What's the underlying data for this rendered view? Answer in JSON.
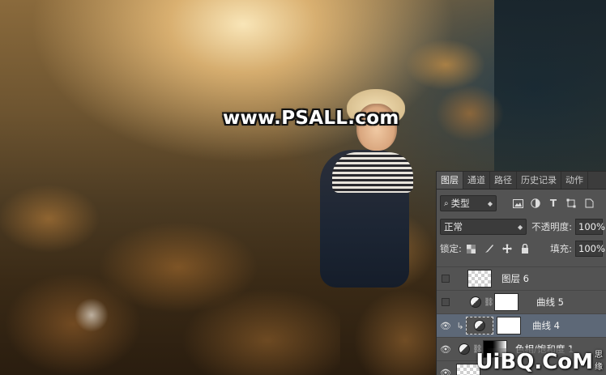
{
  "photo": {
    "watermark": "www.PSALL.com"
  },
  "layers_panel": {
    "tabs": [
      "图层",
      "通道",
      "路径",
      "历史记录",
      "动作"
    ],
    "filter": {
      "kind_label": "类型",
      "icons": [
        "image-filter-icon",
        "adjustment-filter-icon",
        "type-filter-icon",
        "shape-filter-icon",
        "smart-object-filter-icon"
      ]
    },
    "blend_mode": "正常",
    "opacity_label": "不透明度:",
    "opacity_value": "100%",
    "lock_label": "锁定:",
    "fill_label": "填充:",
    "fill_value": "100%",
    "layers": [
      {
        "name": "图层 6",
        "visible": false,
        "thumb": "checker",
        "selected": false
      },
      {
        "name": "曲线 5",
        "visible": false,
        "thumb": "white",
        "selected": false
      },
      {
        "name": "曲线 4",
        "visible": true,
        "thumb": "white",
        "selected": true
      },
      {
        "name": "色相/饱和度 1",
        "visible": true,
        "thumb": "gradient",
        "selected": false
      },
      {
        "name": "",
        "visible": true,
        "thumb": "checker",
        "selected": false
      }
    ]
  },
  "site_watermark": {
    "text": "UiBQ.CoM",
    "suffix": "思缘"
  }
}
